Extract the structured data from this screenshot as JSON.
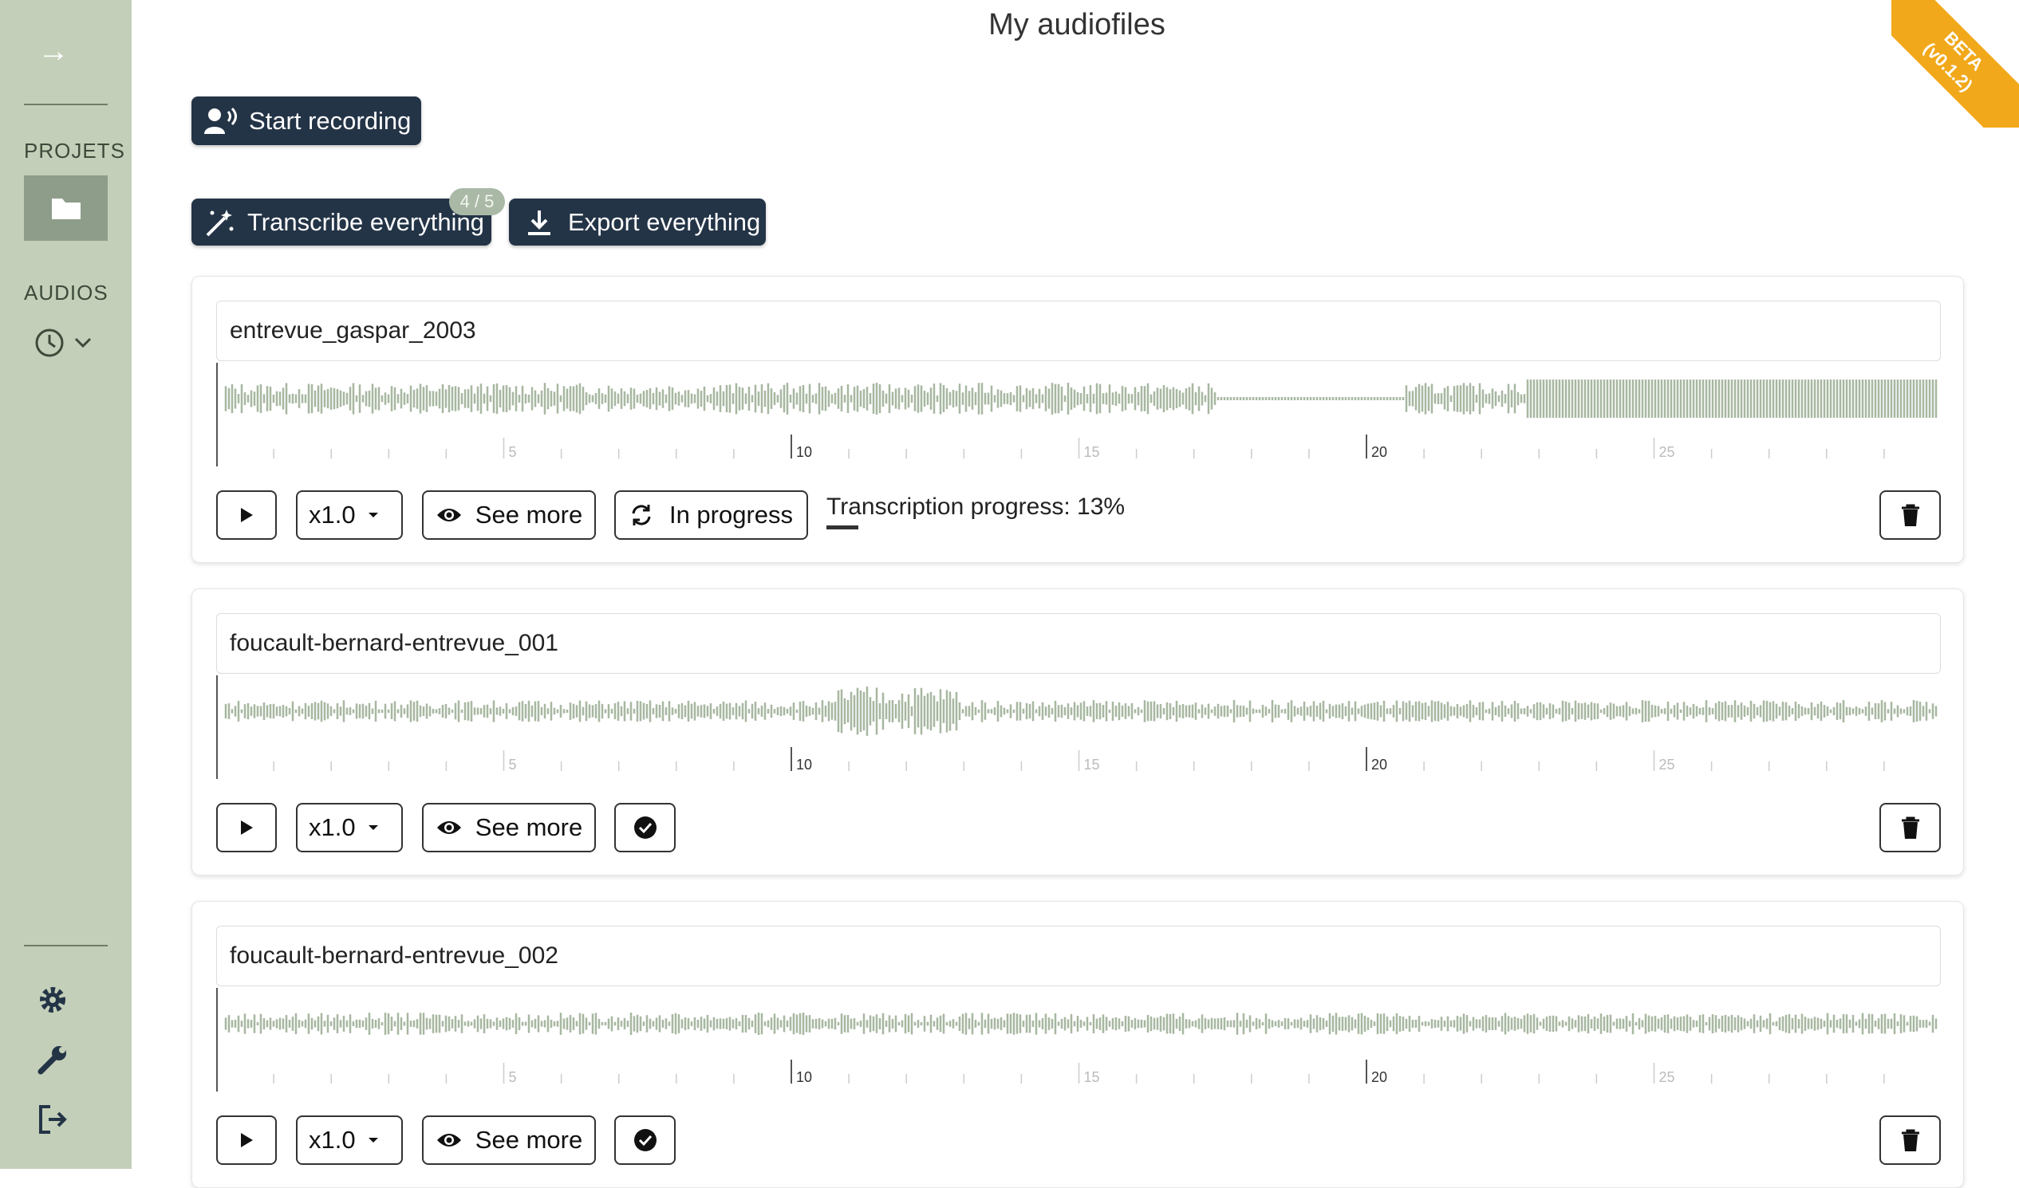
{
  "page_title": "My audiofiles",
  "beta_badge": "BETA\n(v0.1.2)",
  "sidebar": {
    "projects_label": "PROJETS",
    "audios_label": "AUDIOS"
  },
  "toolbar": {
    "start_recording": "Start recording",
    "transcribe_everything": "Transcribe everything",
    "transcribe_count": "4 / 5",
    "export_everything": "Export everything"
  },
  "cards": [
    {
      "title": "entrevue_gaspar_2003",
      "speed": "x1.0",
      "see_more": "See more",
      "status": "In progress",
      "progress_text": "Transcription progress: 13%"
    },
    {
      "title": "foucault-bernard-entrevue_001",
      "speed": "x1.0",
      "see_more": "See more"
    },
    {
      "title": "foucault-bernard-entrevue_002",
      "speed": "x1.0",
      "see_more": "See more"
    }
  ],
  "timeline_ticks": [
    "5",
    "10",
    "15",
    "20",
    "25"
  ],
  "colors": {
    "sidebar": "#c3cfb8",
    "button_dark": "#243447",
    "wave": "#a7b7a0",
    "beta": "#f1a81a"
  }
}
